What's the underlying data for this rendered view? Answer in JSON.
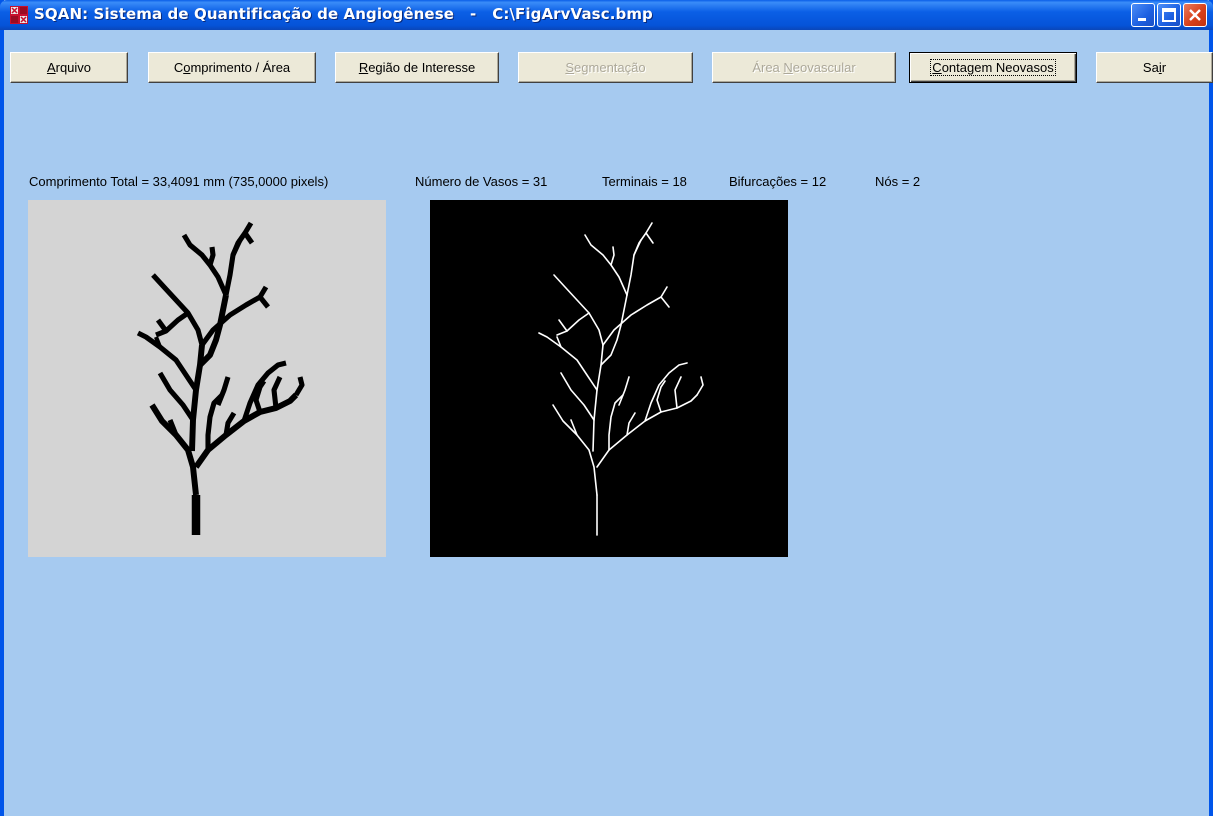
{
  "window": {
    "title": "SQAN: Sistema de Quantificação de Angiogênese",
    "separator": "-",
    "file_path": "C:\\FigArvVasc.bmp"
  },
  "toolbar": {
    "buttons": [
      {
        "label": "Arquivo",
        "mnemonic_index": 0,
        "enabled": true
      },
      {
        "label": "Comprimento / Área",
        "mnemonic_index": 1,
        "enabled": true
      },
      {
        "label": "Região de Interesse",
        "mnemonic_index": 0,
        "enabled": true
      },
      {
        "label": "Segmentação",
        "mnemonic_index": 0,
        "enabled": false
      },
      {
        "label": "Área Neovascular",
        "mnemonic_index": 5,
        "enabled": false
      },
      {
        "label": "Contagem Neovasos",
        "mnemonic_index": 0,
        "enabled": true,
        "focused": true
      },
      {
        "label": "Sair",
        "mnemonic_index": 2,
        "enabled": true
      }
    ]
  },
  "stats": {
    "comprimento_total": "Comprimento Total = 33,4091 mm (735,0000 pixels)",
    "numero_vasos": "Número de Vasos = 31",
    "terminais": "Terminais = 18",
    "bifurcacoes": "Bifurcações = 12",
    "nos": "Nós = 2"
  },
  "images": {
    "original": {
      "name": "vascular-tree-original",
      "background": "#d4d4d4",
      "stroke": "#000000"
    },
    "skeleton": {
      "name": "vascular-tree-skeleton",
      "background": "#000000",
      "stroke": "#ffffff"
    }
  },
  "colors": {
    "client_background": "#a6caf0",
    "titlebar": "#0553d8",
    "button_face": "#ece9d8",
    "disabled_text": "#aca899"
  }
}
